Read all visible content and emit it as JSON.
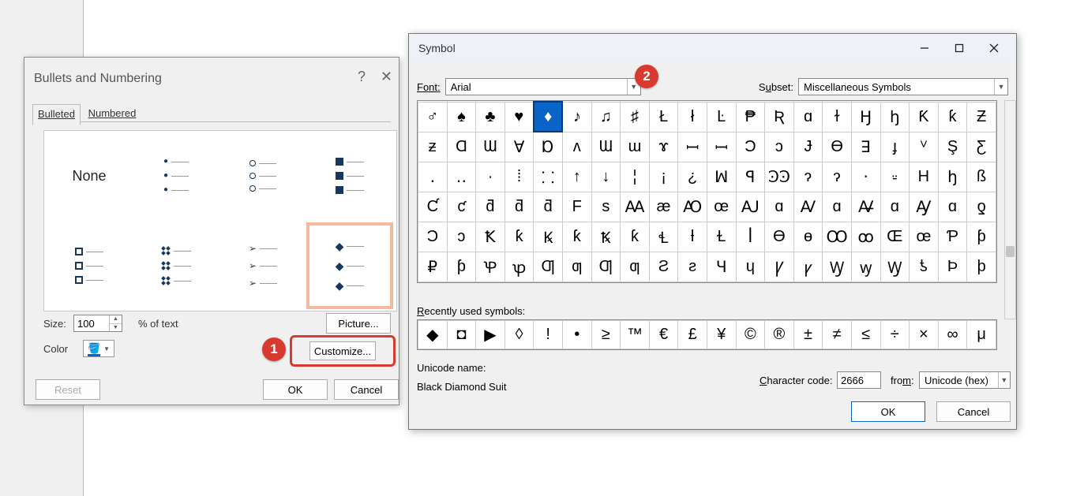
{
  "bullets_dialog": {
    "title": "Bullets and Numbering",
    "help": "?",
    "close": "✕",
    "tab_bulleted": "Bulleted",
    "tab_numbered": "Numbered",
    "none": "None",
    "size_label": "Size:",
    "size_value": "100",
    "pct_label": "% of text",
    "color_label": "Color",
    "picture": "Picture...",
    "customize": "Customize...",
    "reset": "Reset",
    "ok": "OK",
    "cancel": "Cancel"
  },
  "symbol_dialog": {
    "title": "Symbol",
    "font_label": "Font:",
    "font_value": "Arial",
    "subset_label": "Subset:",
    "subset_value": "Miscellaneous Symbols",
    "grid": [
      [
        "♂",
        "♠",
        "♣",
        "♥",
        "♦",
        "♪",
        "♫",
        "♯",
        "Ł",
        "ł",
        "Ŀ",
        "₱",
        "Ʀ",
        "ɑ",
        "ɫ",
        "Ꜧ",
        "ꜧ",
        "Ƙ",
        "ƙ",
        "Ƶ"
      ],
      [
        "ƶ",
        "Ɑ",
        "Ɯ",
        "Ɐ",
        "Ɒ",
        "ᴧ",
        "Ɯ",
        "ɯ",
        "ɤ",
        "ꟷ",
        "ꟷ",
        "Ɔ",
        "ɔ",
        "Ɉ",
        "Ɵ",
        "ꓱ",
        "ɟ",
        "ⱽ",
        "Ş",
        "Ƹ"
      ],
      [
        "․",
        "‥",
        "∙",
        "⁞",
        "⸬",
        "↑",
        "↓",
        "¦",
        "¡",
        "¿",
        "ꟽ",
        "ꟼ",
        "ꜾꜾ",
        "ɂ",
        "ɂ",
        "‧",
        "⸚",
        "H",
        "ꜧ",
        "ß"
      ],
      [
        "Ƈ",
        "ƈ",
        "ƌ",
        "ƌ",
        "ƌ",
        "F",
        "s",
        "Ꜳ",
        "æ",
        "Ꜵ",
        "œ",
        "Ꜷ",
        "ɑ",
        "Ꜹ",
        "ɑ",
        "Ꜻ",
        "ɑ",
        "Ꜽ",
        "ɑ",
        "ƍ"
      ],
      [
        "Ɔ",
        "ɔ",
        "Ꝁ",
        "ƙ",
        "Ꝃ",
        "ƙ",
        "Ꝅ",
        "ƙ",
        "Ɬ",
        "ƚ",
        "Ɫ",
        "ꟾ",
        "Ɵ",
        "ɵ",
        "Ꝏ",
        "ꝏ",
        "Œ",
        "œ",
        "Ƥ",
        "ƥ"
      ],
      [
        "₽",
        "ƥ",
        "Ꝕ",
        "ꝕ",
        "Ƣ",
        "ƣ",
        "Ƣ",
        "ƣ",
        "Ƨ",
        "ƨ",
        "Ɥ",
        "ɥ",
        "Ꝩ",
        "ꝩ",
        "Ꝡ",
        "ꝡ",
        "Ꝡ",
        "ƾ",
        "Þ",
        "þ"
      ]
    ],
    "selected_row": 0,
    "selected_col": 4,
    "recent_label": "Recently used symbols:",
    "recent": [
      "◆",
      "◘",
      "▶",
      "◊",
      "!",
      "•",
      "≥",
      "™",
      "€",
      "£",
      "¥",
      "©",
      "®",
      "±",
      "≠",
      "≤",
      "÷",
      "×",
      "∞",
      "μ"
    ],
    "unicode_label": "Unicode name:",
    "unicode_name": "Black Diamond Suit",
    "cc_label": "Character code:",
    "cc_value": "2666",
    "from_label": "from:",
    "from_value": "Unicode (hex)",
    "ok": "OK",
    "cancel": "Cancel"
  },
  "badges": {
    "one": "1",
    "two": "2"
  }
}
